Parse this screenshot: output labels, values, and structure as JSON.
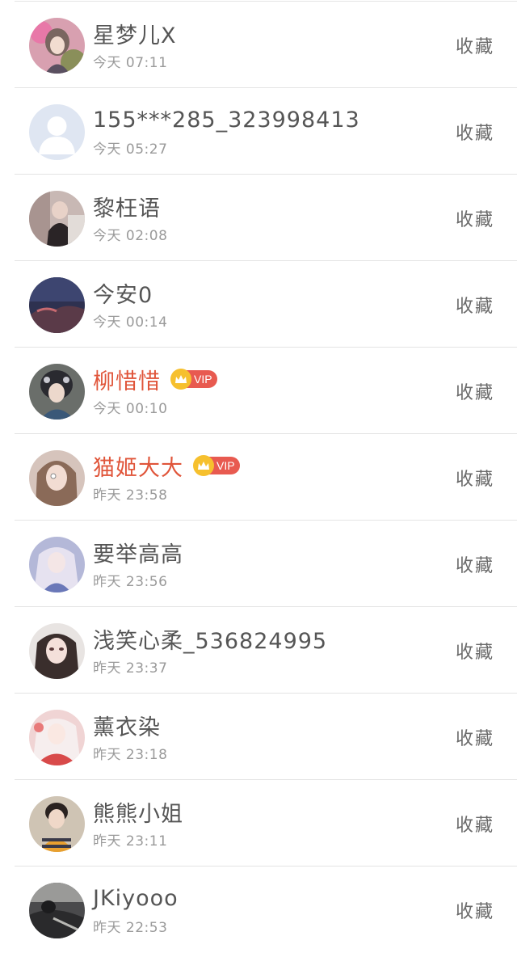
{
  "contacts": [
    {
      "name": "星梦儿X",
      "time": "今天 07:11",
      "vip": false,
      "avatar": "anime-girl-avatar",
      "action": "收藏"
    },
    {
      "name": "155***285_323998413",
      "time": "今天 05:27",
      "vip": false,
      "avatar": "default-person-avatar",
      "action": "收藏"
    },
    {
      "name": "黎枉语",
      "time": "今天 02:08",
      "vip": false,
      "avatar": "photo-avatar",
      "action": "收藏"
    },
    {
      "name": "今安0",
      "time": "今天 00:14",
      "vip": false,
      "avatar": "night-sky-avatar",
      "action": "收藏"
    },
    {
      "name": "柳惜惜",
      "time": "今天 00:10",
      "vip": true,
      "vip_label": "VIP",
      "avatar": "costume-girl-avatar",
      "action": "收藏"
    },
    {
      "name": "猫姬大大",
      "time": "昨天 23:58",
      "vip": true,
      "vip_label": "VIP",
      "avatar": "selfie-girl-avatar",
      "action": "收藏"
    },
    {
      "name": "要举高高",
      "time": "昨天 23:56",
      "vip": false,
      "avatar": "anime-purple-avatar",
      "action": "收藏"
    },
    {
      "name": "浅笑心柔_536824995",
      "time": "昨天 23:37",
      "vip": false,
      "avatar": "selfie-girl-avatar",
      "action": "收藏"
    },
    {
      "name": "薰衣染",
      "time": "昨天 23:18",
      "vip": false,
      "avatar": "anime-red-avatar",
      "action": "收藏"
    },
    {
      "name": "熊熊小姐",
      "time": "昨天 23:11",
      "vip": false,
      "avatar": "photo-girl-avatar",
      "action": "收藏"
    },
    {
      "name": "JKiyooo",
      "time": "昨天 22:53",
      "vip": false,
      "avatar": "dark-photo-avatar",
      "action": "收藏"
    }
  ],
  "colors": {
    "name": "#555555",
    "vip_name": "#e0553a",
    "time": "#9a9a9a",
    "action": "#6a6a6a",
    "divider": "#e4e4e4",
    "vip_badge": "#e85a50",
    "crown": "#f6c02e"
  },
  "icons": {
    "crown": "crown-icon"
  }
}
